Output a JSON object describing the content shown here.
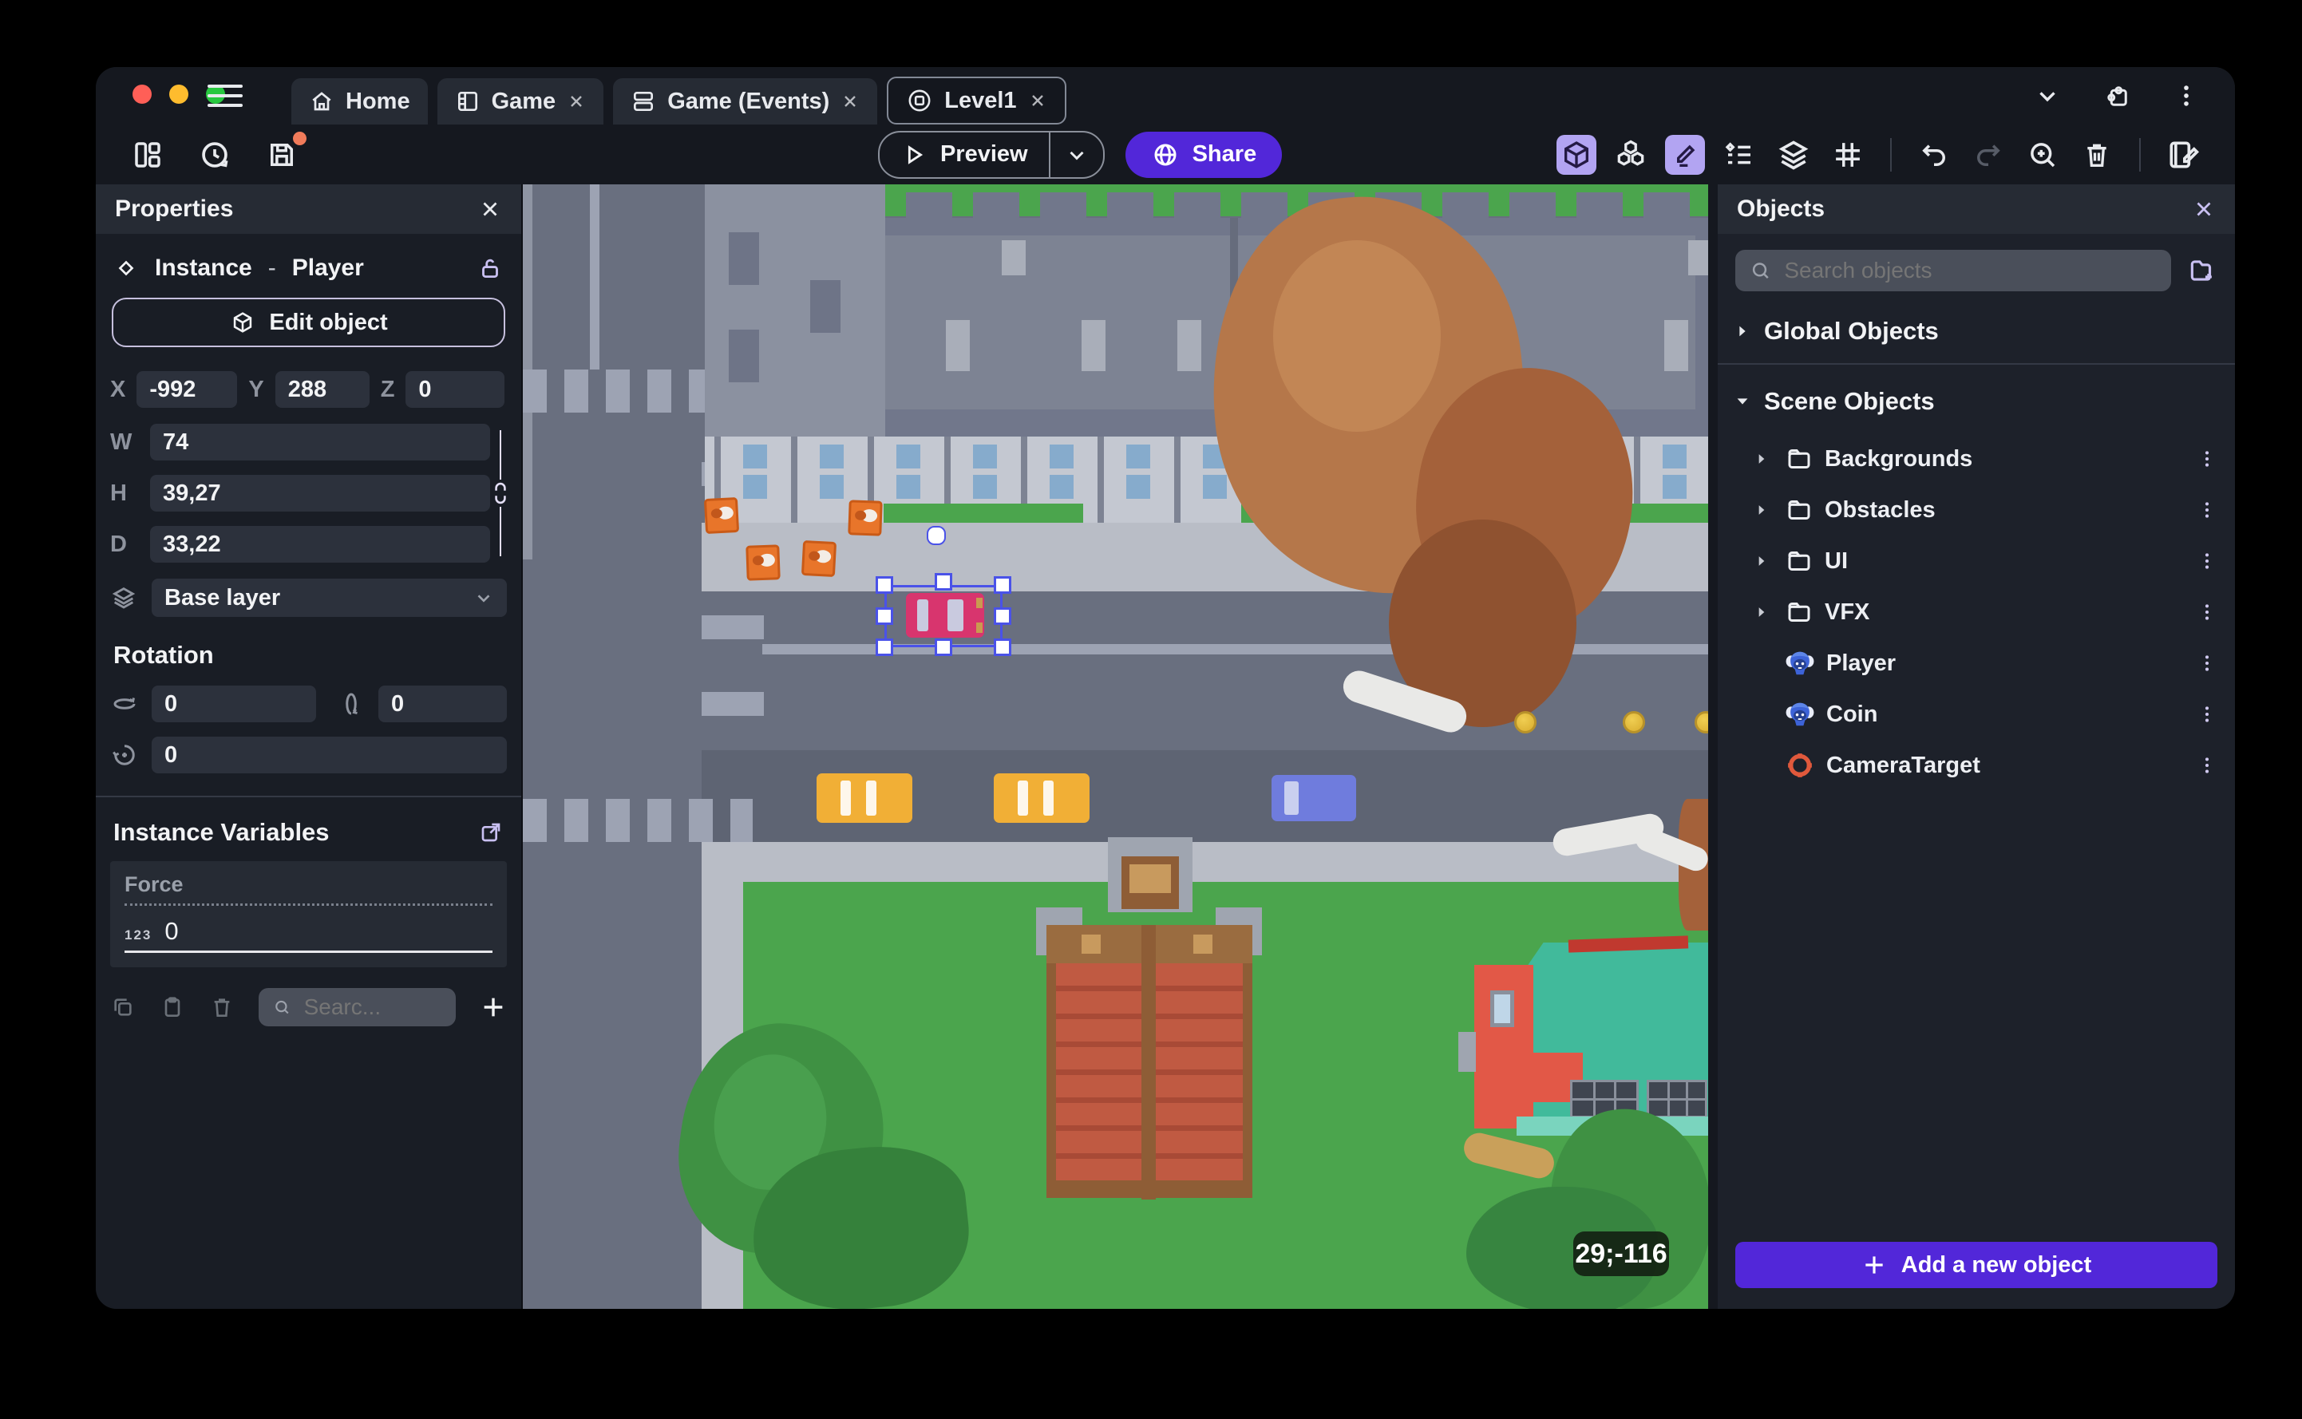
{
  "titlebar": {
    "tabs": [
      {
        "label": "Home"
      },
      {
        "label": "Game"
      },
      {
        "label": "Game (Events)"
      },
      {
        "label": "Level1"
      }
    ]
  },
  "toolbar": {
    "preview_label": "Preview",
    "share_label": "Share"
  },
  "properties_panel": {
    "title": "Properties",
    "instance": {
      "kind": "Instance",
      "separator": "-",
      "name": "Player"
    },
    "edit_object_label": "Edit object",
    "position": {
      "x_label": "X",
      "x": "-992",
      "y_label": "Y",
      "y": "288",
      "z_label": "Z",
      "z": "0"
    },
    "size": {
      "w_label": "W",
      "w": "74",
      "h_label": "H",
      "h": "39,27",
      "d_label": "D",
      "d": "33,22"
    },
    "layer": "Base layer",
    "rotation": {
      "title": "Rotation",
      "rx": "0",
      "ry": "0",
      "rz": "0"
    },
    "variables": {
      "title": "Instance Variables",
      "name": "Force",
      "type_badge": "123",
      "value": "0",
      "search_placeholder": "Searc..."
    }
  },
  "objects_panel": {
    "title": "Objects",
    "search_placeholder": "Search objects",
    "sections": {
      "global": "Global Objects",
      "scene": "Scene Objects"
    },
    "items": [
      {
        "label": "Backgrounds"
      },
      {
        "label": "Obstacles"
      },
      {
        "label": "UI"
      },
      {
        "label": "VFX"
      },
      {
        "label": "Player"
      },
      {
        "label": "Coin"
      },
      {
        "label": "CameraTarget"
      }
    ],
    "add_button": "Add a new object"
  },
  "canvas": {
    "coords_badge": "29;-116"
  },
  "colors": {
    "accent": "#5227D9",
    "accent_light": "#B2A4F2",
    "selection": "#4A52E8",
    "unsaved": "#F07B5A"
  }
}
